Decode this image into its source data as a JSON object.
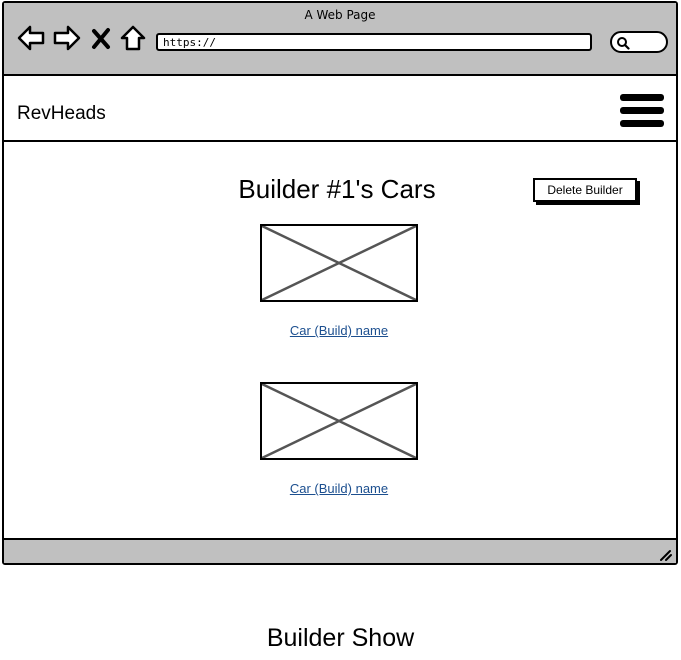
{
  "window": {
    "title": "A Web Page"
  },
  "browser": {
    "address": "https://",
    "icons": [
      "back-arrow-icon",
      "forward-arrow-icon",
      "close-icon",
      "home-icon",
      "search-icon",
      "resize-grip-icon"
    ]
  },
  "header": {
    "brand": "RevHeads",
    "menu_icon": "hamburger-menu-icon"
  },
  "main": {
    "title": "Builder #1's Cars",
    "delete_label": "Delete Builder",
    "cars": [
      {
        "name": "Car (Build) name"
      },
      {
        "name": "Car (Build) name"
      }
    ]
  },
  "caption": "Builder Show",
  "colors": {
    "chrome": "#c0c0c0",
    "link": "#1c4f8f",
    "placeholder_stroke": "#555555"
  }
}
